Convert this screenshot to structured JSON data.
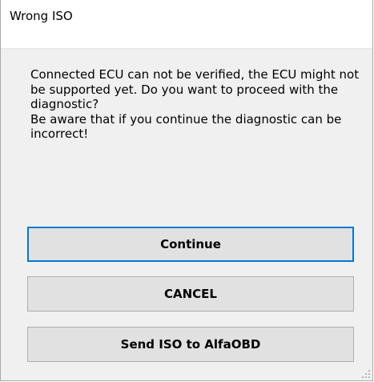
{
  "window": {
    "title": "Wrong ISO"
  },
  "message": {
    "text": "Connected ECU can not be verified, the ECU might not be supported yet. Do you want to proceed with the diagnostic?\nBe aware that if you continue the diagnostic can be incorrect!"
  },
  "buttons": {
    "continue_label": "Continue",
    "cancel_label": "CANCEL",
    "send_iso_label": "Send ISO to AlfaOBD"
  },
  "colors": {
    "accent": "#0078d7",
    "button_bg": "#e1e1e1",
    "dialog_bg": "#f0f0f0"
  }
}
